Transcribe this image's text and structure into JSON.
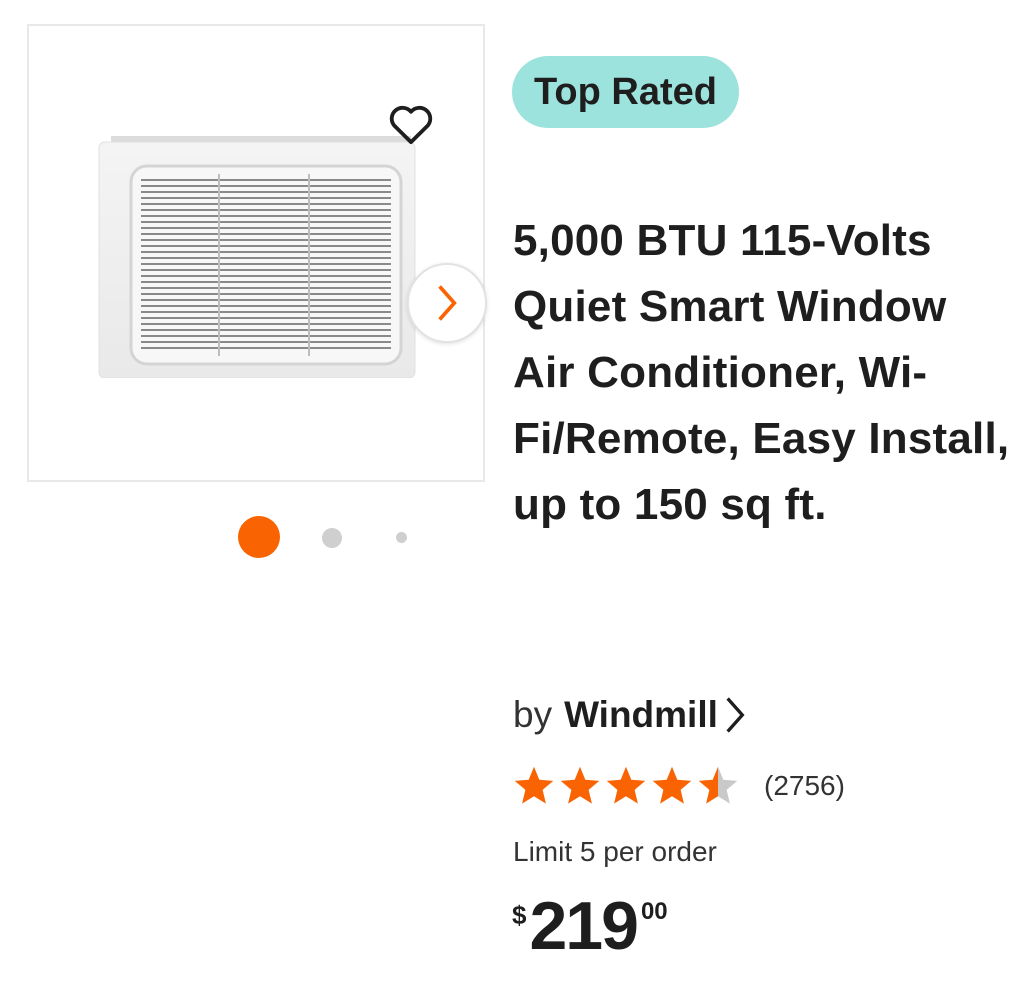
{
  "badge": {
    "label": "Top Rated",
    "color": "#9de3dd"
  },
  "product": {
    "title": "5,000 BTU 115-Volts Quiet Smart Window Air Conditioner, Wi-Fi/Remote, Easy Install, up to 150 sq ft.",
    "image_icon": "window-air-conditioner",
    "by_label": "by",
    "brand": "Windmill",
    "rating": 4.5,
    "rating_max": 5,
    "review_count": "(2756)",
    "limit": "Limit 5 per order",
    "price": {
      "currency": "$",
      "dollars": "219",
      "cents": "00"
    }
  },
  "gallery": {
    "favorite_icon": "heart-outline-icon",
    "next_icon": "chevron-right-icon",
    "slides": 3,
    "active_slide": 1
  },
  "colors": {
    "accent": "#f96302",
    "star_filled": "#f96302",
    "star_empty": "#c9c9c9",
    "text": "#1e1e1e"
  }
}
